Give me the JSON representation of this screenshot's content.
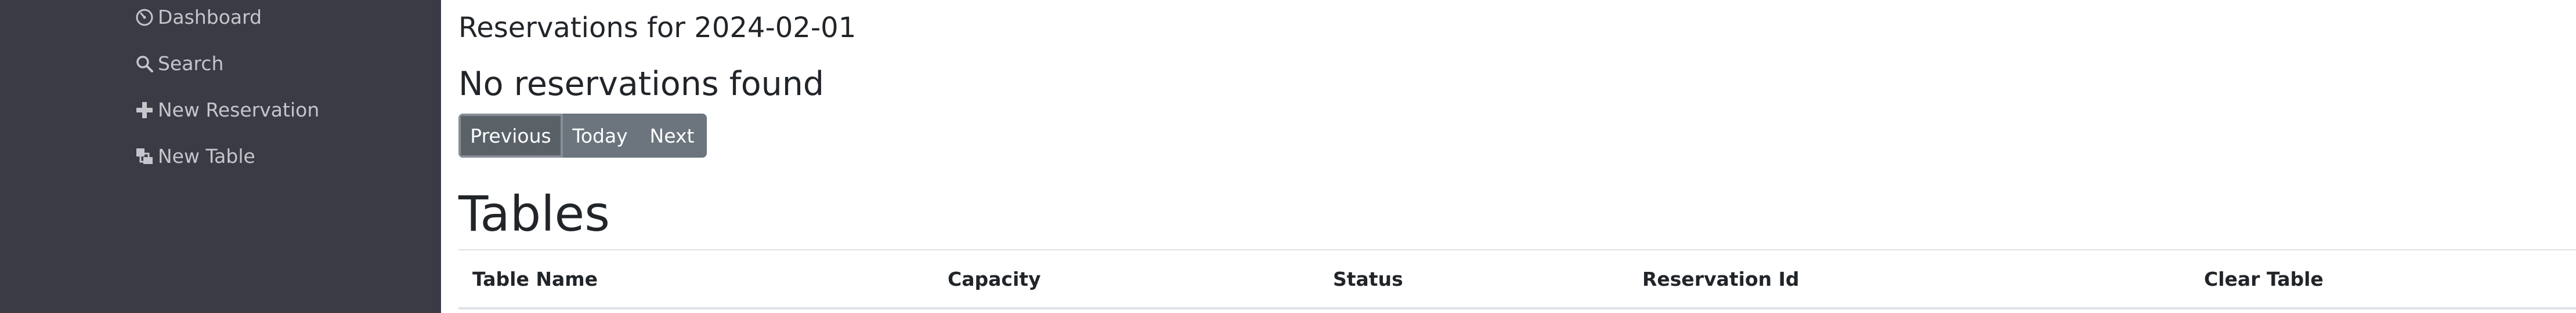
{
  "sidebar": {
    "items": [
      {
        "label": "Dashboard",
        "icon": "dashboard-icon"
      },
      {
        "label": "Search",
        "icon": "search-icon"
      },
      {
        "label": "New Reservation",
        "icon": "plus-icon"
      },
      {
        "label": "New Table",
        "icon": "table-icon"
      }
    ]
  },
  "main": {
    "reservations_title": "Reservations for 2024-02-01",
    "empty_message": "No reservations found",
    "buttons": {
      "previous": "Previous",
      "today": "Today",
      "next": "Next"
    },
    "tables_title": "Tables",
    "table": {
      "headers": [
        "Table Name",
        "Capacity",
        "Status",
        "Reservation Id",
        "Clear Table"
      ],
      "rows": []
    }
  },
  "colors": {
    "sidebar_bg": "#3a3b45",
    "sidebar_text": "#c5c6cc",
    "button_bg": "#6c757d",
    "button_text": "#ffffff"
  }
}
